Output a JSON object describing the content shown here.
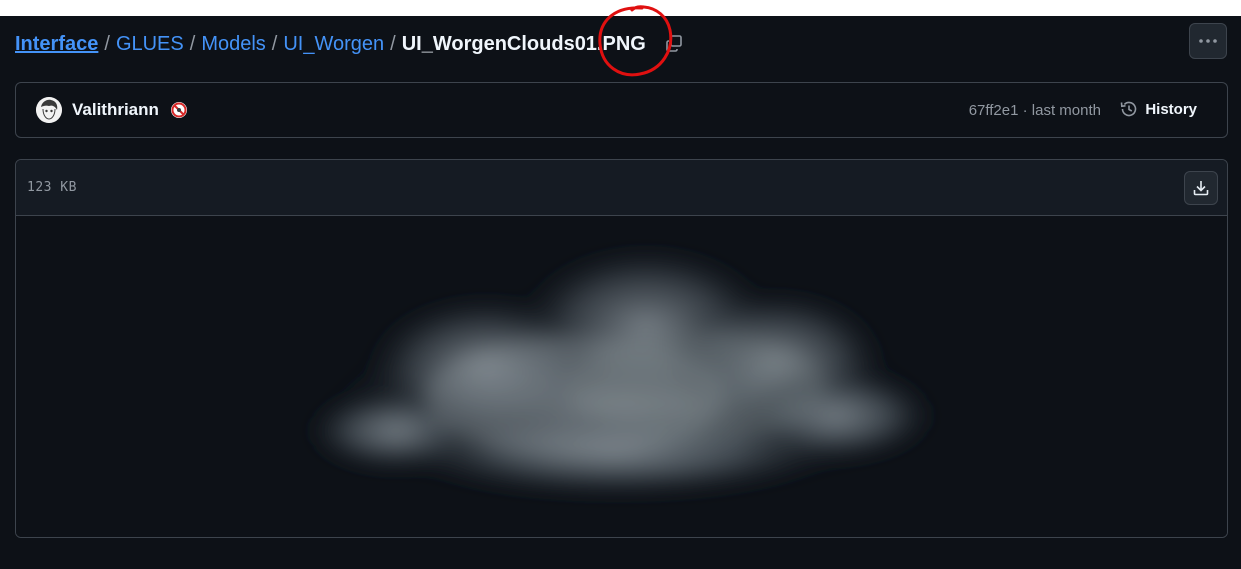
{
  "breadcrumb": {
    "items": [
      "Interface",
      "GLUES",
      "Models",
      "UI_Worgen"
    ],
    "separator": "/",
    "current": "UI_WorgenClouds01.PNG"
  },
  "icons": {
    "copy": "copy-icon",
    "more": "kebab-horizontal-icon",
    "history": "history-icon",
    "download": "download-icon"
  },
  "commit": {
    "author": "Valithriann",
    "meta": "67ff2e1 · last month",
    "history_label": "History"
  },
  "file": {
    "size": "123 KB"
  },
  "colors": {
    "background": "#0d1117",
    "link": "#4493f8",
    "muted": "#9198a1",
    "border": "#3d444d",
    "annotation": "#e01010"
  }
}
